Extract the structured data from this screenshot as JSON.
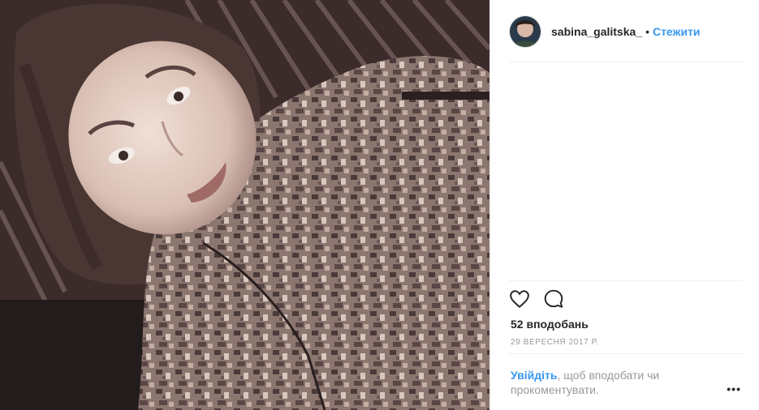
{
  "post": {
    "photo_icon": "selfie-photo",
    "author": {
      "username": "sabina_galitska_",
      "separator": "•",
      "follow_label": "Стежити"
    },
    "actions": {
      "like_icon": "heart-icon",
      "comment_icon": "comment-icon"
    },
    "likes_text": "52 вподобань",
    "date_text": "29 ВЕРЕСНЯ 2017 Р.",
    "login_prompt": {
      "link_text": "Увійдіть",
      "rest_text": ", щоб вподобати чи прокоментувати."
    },
    "more_icon": "more-options-icon"
  },
  "colors": {
    "link": "#3897f0",
    "text": "#262626",
    "muted": "#999999"
  }
}
